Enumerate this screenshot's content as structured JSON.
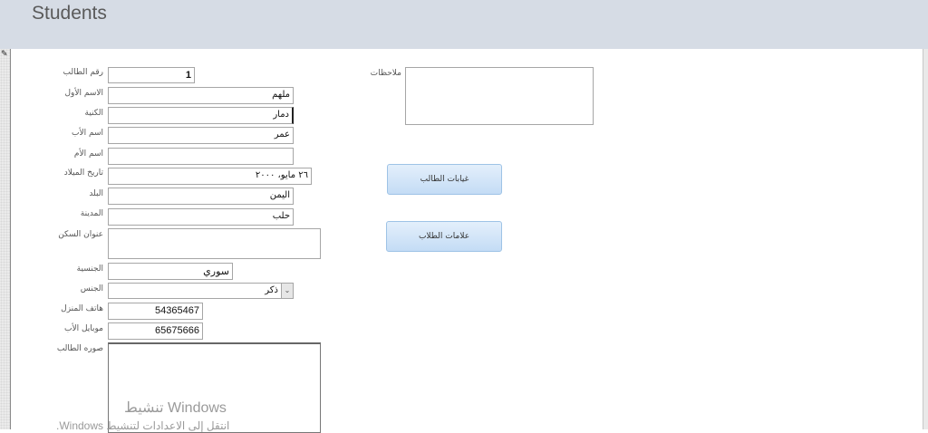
{
  "title": "Students",
  "fields": [
    {
      "label": "رقم الطالب",
      "value": "1"
    },
    {
      "label": "الاسم الأول",
      "value": "ملهم"
    },
    {
      "label": "الكنية",
      "value": "دمار"
    },
    {
      "label": "اسم الأب",
      "value": "عمر"
    },
    {
      "label": "اسم الأم",
      "value": ""
    },
    {
      "label": "تاريخ الميلاد",
      "value": "٢٦ مايو، ٢٠٠٠"
    },
    {
      "label": "البلد",
      "value": "اليمن"
    },
    {
      "label": "المدينة",
      "value": "حلب"
    },
    {
      "label": "عنوان السكن",
      "value": ""
    },
    {
      "label": "الجنسية",
      "value": "سوري"
    },
    {
      "label": "الجنس",
      "value": "ذكر"
    },
    {
      "label": "هاتف المنزل",
      "value": "54365467"
    },
    {
      "label": "موبايل الأب",
      "value": "65675666"
    },
    {
      "label": "صوره الطالب",
      "value": ""
    }
  ],
  "notes": {
    "label": "ملاحظات",
    "value": ""
  },
  "buttons": {
    "absences": "غيابات الطالب",
    "grades": "علامات الطلاب"
  },
  "watermark": {
    "line1": "تنشيط Windows",
    "line2": "انتقل إلى الاعدادات لتنشيط Windows."
  }
}
